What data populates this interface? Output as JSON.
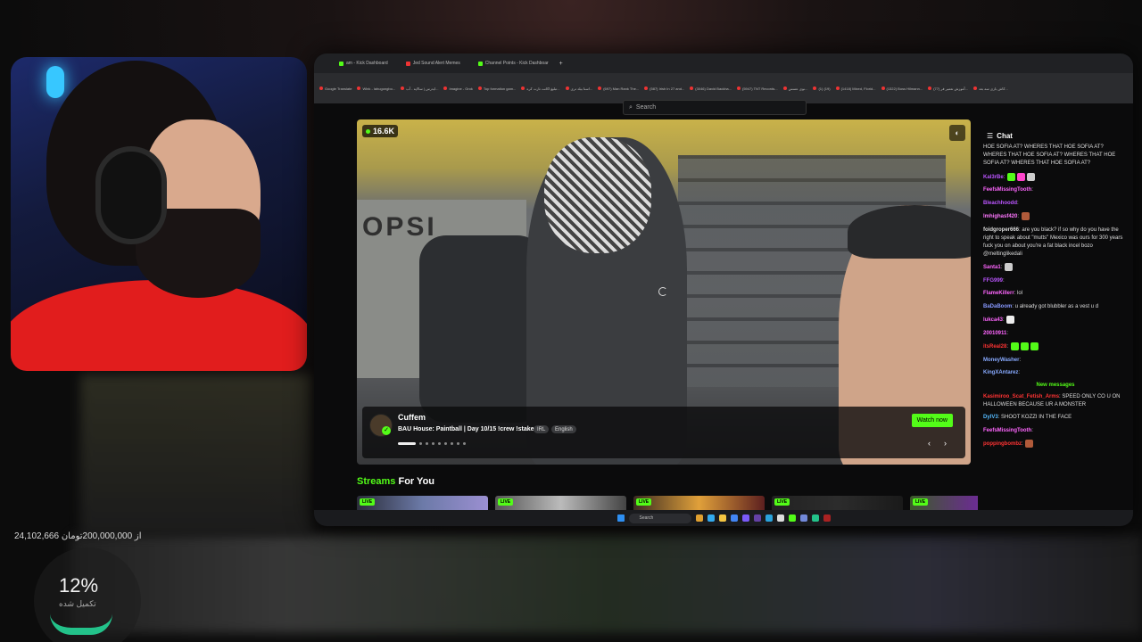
{
  "overlay": {
    "donation_line": "24,102,666 از 200,000,000تومان",
    "percent": "12%",
    "percent_sub": "تکمیل شده"
  },
  "browser": {
    "tabs": [
      {
        "label": "am - Kick Dashboard",
        "color": "#53fc18"
      },
      {
        "label": "Jed Sound Alert Memes",
        "color": "#e33"
      },
      {
        "label": "Channel Points - Kick Dashboar",
        "color": "#53fc18"
      }
    ],
    "new_tab": "+",
    "bookmarks": [
      "Google Translate",
      "Wlnk - lahugongbo...",
      "ایدرس | سالاپه - آب...",
      "Imagine - Grok",
      "Top formation gam...",
      "تبلیغ اکانت تارت کره...",
      "اسنا بیلد تری...",
      "(697) Man Rank The...",
      "(587) Irish In 27 and...",
      "(3046) David Backha...",
      "(5947) TNT Records...",
      "نوی عسس...",
      "(1) (19)",
      "(1418) Mixed, Florid...",
      "(1322) Boss Hilmann...",
      "(77) آموزش تعمیر فر...",
      "کاش بازی سه بعد..."
    ]
  },
  "search": {
    "placeholder": "Search"
  },
  "player": {
    "viewers": "16.6K",
    "board_text": "OPSI",
    "streamer": "Cuffem",
    "title": "BAU House: Paintball | Day 10/15 !crew !stake",
    "tags": [
      "IRL",
      "English"
    ],
    "watch_now": "Watch now",
    "carousel_count": 9,
    "carousel_active": 0
  },
  "streams": {
    "heading_green": "Streams",
    "heading_rest": " For You",
    "live_label": "LIVE",
    "thumbs": [
      {
        "bg": "linear-gradient(90deg,#2b2d3a,#6c7aa8,#9b8fd1)"
      },
      {
        "bg": "linear-gradient(90deg,#555,#bbb,#444)"
      },
      {
        "bg": "linear-gradient(90deg,#3a2b22,#e0a03a,#5c1f1f)"
      },
      {
        "bg": "linear-gradient(90deg,#222,#2c2c2c,#1a1a1a)"
      },
      {
        "bg": "linear-gradient(90deg,#3c5a2a,#6a2d8f,#c7c7c7)"
      },
      {
        "bg": "linear-gradient(90deg,#222,#b33,#eee)"
      }
    ]
  },
  "taskbar": {
    "search": "Search",
    "icons": [
      "#e0a030",
      "#33aaee",
      "#f5c542",
      "#4285f4",
      "#7a5af8",
      "#6441a5",
      "#2aa3dc",
      "#ddd",
      "#53fc18",
      "#7289da",
      "#23c28a",
      "#aa2222"
    ]
  },
  "chat": {
    "title": "Chat",
    "messages": [
      {
        "user": "",
        "color": "#ddd",
        "text": "HOE SOFIA AT? WHERES THAT HOE SOFIA AT? WHERES THAT HOE SOFIA AT? WHERES THAT HOE SOFIA AT? WHERES THAT HOE SOFIA AT?",
        "emotes": []
      },
      {
        "user": "Kal3rBe",
        "color": "#bb55ff",
        "text": "",
        "emotes": [
          "#53fc18",
          "#ff44cc",
          "#cccccc"
        ]
      },
      {
        "user": "FeefsMissingTooth",
        "color": "#ff66ff",
        "text": "",
        "emotes": []
      },
      {
        "user": "Bleachhoodd",
        "color": "#bb55ff",
        "text": "",
        "emotes": []
      },
      {
        "user": "lmhighasf420",
        "color": "#ff77ff",
        "text": "",
        "emotes": [
          "#b05a3a"
        ]
      },
      {
        "user": "foidgroper666",
        "color": "#ddd",
        "text": "are you black? if so why do you have the right to speak about \"mutts\" Mexico was ours for 300 years fuck you on about you're a fat black incel bozo @meltinglikedali",
        "emotes": []
      },
      {
        "user": "Santa1",
        "color": "#ff66ff",
        "text": "",
        "emotes": [
          "#cccccc"
        ]
      },
      {
        "user": "FFG999",
        "color": "#bb55ff",
        "text": "",
        "emotes": []
      },
      {
        "user": "FlameKillerr",
        "color": "#ff66ff",
        "text": "lol",
        "emotes": []
      },
      {
        "user": "BaDaBoom",
        "color": "#8899ff",
        "text": "u already got blubbler as a vest u d",
        "emotes": []
      },
      {
        "user": "lukca43",
        "color": "#ff66ff",
        "text": "",
        "emotes": [
          "#eeeeee"
        ]
      },
      {
        "user": "20010911",
        "color": "#ff66ff",
        "text": "",
        "emotes": []
      },
      {
        "user": "itsReal28",
        "color": "#ff3333",
        "text": "",
        "emotes": [
          "#53fc18",
          "#53fc18",
          "#53fc18"
        ]
      },
      {
        "user": "MoneyWasher",
        "color": "#88aaff",
        "text": "",
        "emotes": []
      },
      {
        "user": "KingXAntarez",
        "color": "#88aaff",
        "text": "",
        "emotes": []
      },
      {
        "user": "Kasimiroo_Scat_Fetish_Arms",
        "color": "#ff3333",
        "text": "SPEED ONLY CO U ON HALLOWEEN BECAUSE UR A MONSTER",
        "emotes": []
      },
      {
        "user": "DylV3",
        "color": "#55bbff",
        "text": "SHOOT KOZZI IN THE FACE",
        "emotes": []
      },
      {
        "user": "FeefsMissingTooth",
        "color": "#ff66ff",
        "text": "",
        "emotes": []
      },
      {
        "user": "poppingbombz",
        "color": "#ff3333",
        "text": "",
        "emotes": [
          "#b05a3a"
        ]
      }
    ],
    "new_messages": "New messages",
    "new_messages_index": 15
  }
}
